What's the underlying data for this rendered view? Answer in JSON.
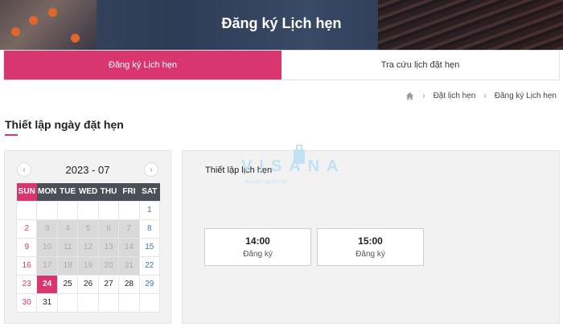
{
  "banner": {
    "title": "Đăng ký Lịch hẹn"
  },
  "tabs": [
    {
      "label": "Đăng ký Lịch hẹn",
      "active": true
    },
    {
      "label": "Tra cứu lịch đặt hẹn",
      "active": false
    }
  ],
  "breadcrumb": {
    "home_icon": "home-icon",
    "items": [
      "Đặt lịch hẹn",
      "Đăng ký Lịch hẹn"
    ]
  },
  "section": {
    "title": "Thiết lập ngày đặt hẹn"
  },
  "calendar": {
    "month_label": "2023 - 07",
    "weekdays": [
      "SUN",
      "MON",
      "TUE",
      "WED",
      "THU",
      "FRI",
      "SAT"
    ],
    "weeks": [
      [
        {
          "d": ""
        },
        {
          "d": ""
        },
        {
          "d": ""
        },
        {
          "d": ""
        },
        {
          "d": ""
        },
        {
          "d": ""
        },
        {
          "d": "1",
          "s": "plain"
        }
      ],
      [
        {
          "d": "2",
          "s": "plain"
        },
        {
          "d": "3",
          "s": "disabled"
        },
        {
          "d": "4",
          "s": "disabled"
        },
        {
          "d": "5",
          "s": "disabled"
        },
        {
          "d": "6",
          "s": "disabled"
        },
        {
          "d": "7",
          "s": "disabled"
        },
        {
          "d": "8",
          "s": "plain"
        }
      ],
      [
        {
          "d": "9",
          "s": "plain"
        },
        {
          "d": "10",
          "s": "disabled"
        },
        {
          "d": "11",
          "s": "disabled"
        },
        {
          "d": "12",
          "s": "disabled"
        },
        {
          "d": "13",
          "s": "disabled"
        },
        {
          "d": "14",
          "s": "disabled"
        },
        {
          "d": "15",
          "s": "plain"
        }
      ],
      [
        {
          "d": "16",
          "s": "plain"
        },
        {
          "d": "17",
          "s": "disabled"
        },
        {
          "d": "18",
          "s": "disabled"
        },
        {
          "d": "19",
          "s": "disabled"
        },
        {
          "d": "20",
          "s": "disabled"
        },
        {
          "d": "21",
          "s": "disabled"
        },
        {
          "d": "22",
          "s": "plain"
        }
      ],
      [
        {
          "d": "23",
          "s": "plain"
        },
        {
          "d": "24",
          "s": "selected"
        },
        {
          "d": "25",
          "s": "avail"
        },
        {
          "d": "26",
          "s": "avail"
        },
        {
          "d": "27",
          "s": "avail"
        },
        {
          "d": "28",
          "s": "avail"
        },
        {
          "d": "29",
          "s": "avail"
        }
      ],
      [
        {
          "d": "30",
          "s": "plain"
        },
        {
          "d": "31",
          "s": "avail"
        },
        {
          "d": ""
        },
        {
          "d": ""
        },
        {
          "d": ""
        },
        {
          "d": ""
        },
        {
          "d": ""
        }
      ]
    ]
  },
  "time_panel": {
    "title": "Thiết lập lịch hẹn",
    "slots": [
      {
        "time": "14:00",
        "action": "Đăng ký"
      },
      {
        "time": "15:00",
        "action": "Đăng ký"
      }
    ]
  },
  "watermark": {
    "brand": "VISANA",
    "tagline": "Visa cho người Việt"
  },
  "colors": {
    "accent": "#d9356f",
    "weekday_header": "#4b4f57",
    "saturday": "#3a78b5",
    "disabled_cell": "#d9d9d9"
  }
}
